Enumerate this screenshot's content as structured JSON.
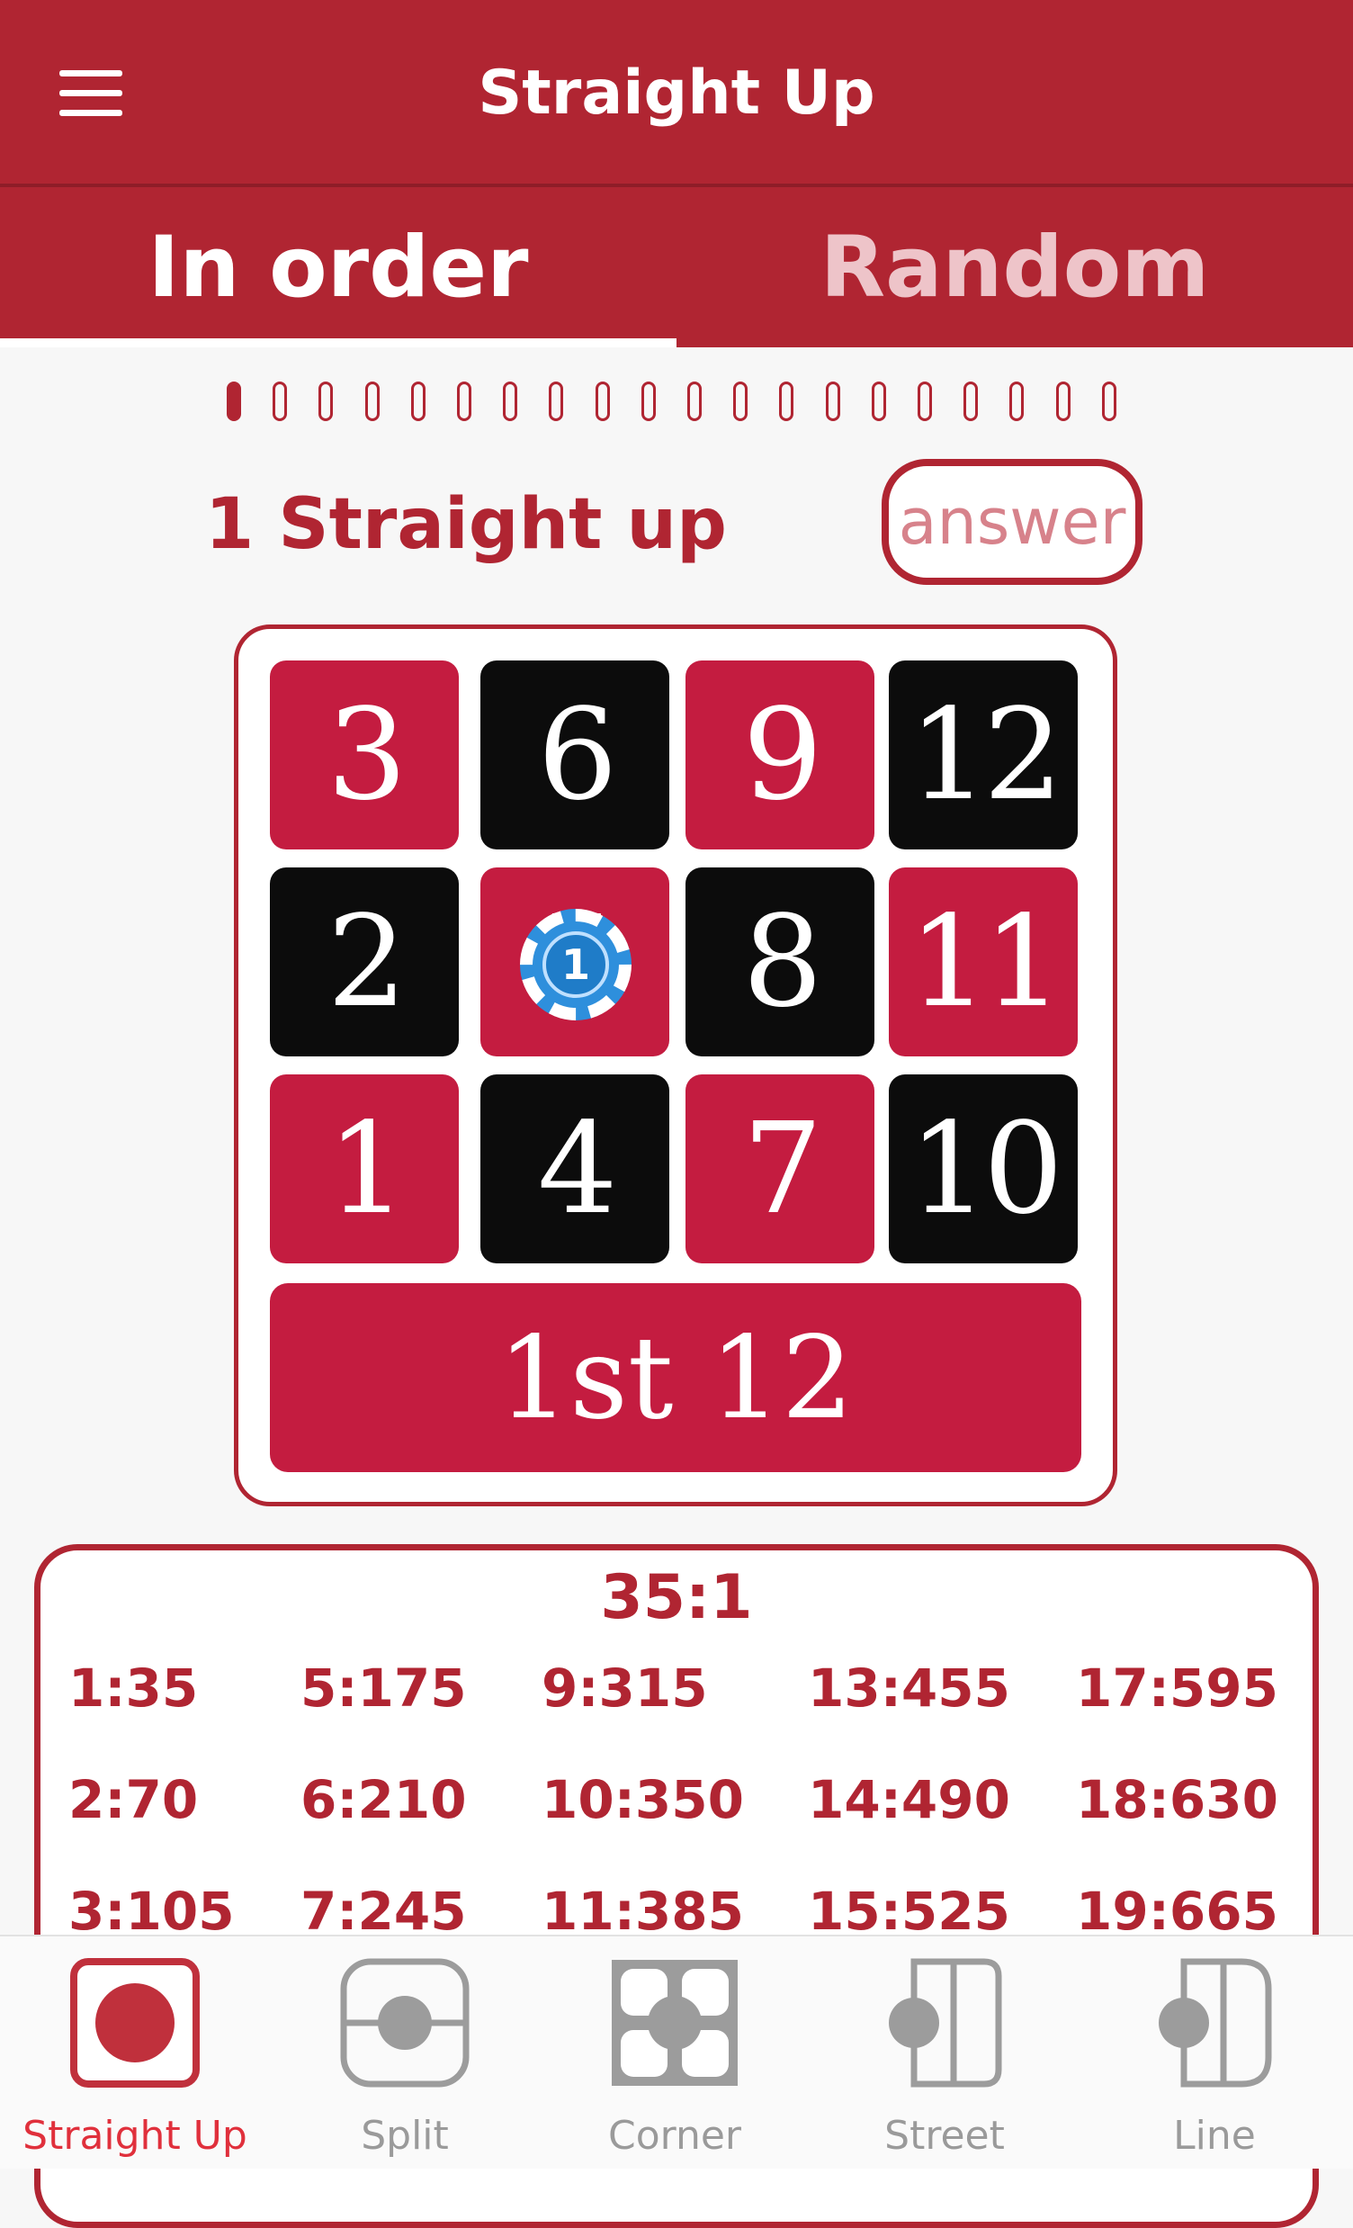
{
  "app": {
    "title": "Straight Up"
  },
  "tabs": [
    {
      "label": "In order",
      "active": true
    },
    {
      "label": "Random",
      "active": false
    }
  ],
  "progress": {
    "total": 20,
    "current": 1
  },
  "question": {
    "title": "1 Straight up",
    "answer_label": "answer"
  },
  "board": {
    "rows": [
      [
        {
          "num": "3",
          "color": "red"
        },
        {
          "num": "6",
          "color": "black"
        },
        {
          "num": "9",
          "color": "red"
        },
        {
          "num": "12",
          "color": "black"
        }
      ],
      [
        {
          "num": "2",
          "color": "black"
        },
        {
          "num": "5",
          "color": "red"
        },
        {
          "num": "8",
          "color": "black"
        },
        {
          "num": "11",
          "color": "red"
        }
      ],
      [
        {
          "num": "1",
          "color": "red"
        },
        {
          "num": "4",
          "color": "black"
        },
        {
          "num": "7",
          "color": "red"
        },
        {
          "num": "10",
          "color": "black"
        }
      ]
    ],
    "dozen": "1st 12",
    "chip": {
      "value": "1",
      "on_number": "5"
    }
  },
  "payout": {
    "ratio": "35:1",
    "columns": [
      [
        "1:35",
        "2:70",
        "3:105"
      ],
      [
        "5:175",
        "6:210",
        "7:245"
      ],
      [
        "9:315",
        "10:350",
        "11:385"
      ],
      [
        "13:455",
        "14:490",
        "15:525"
      ],
      [
        "17:595",
        "18:630",
        "19:665"
      ]
    ]
  },
  "bottom_nav": [
    {
      "label": "Straight Up",
      "icon": "straight-up-icon",
      "active": true
    },
    {
      "label": "Split",
      "icon": "split-icon",
      "active": false
    },
    {
      "label": "Corner",
      "icon": "corner-icon",
      "active": false
    },
    {
      "label": "Street",
      "icon": "street-icon",
      "active": false
    },
    {
      "label": "Line",
      "icon": "line-icon",
      "active": false
    }
  ],
  "colors": {
    "primary": "#b02532",
    "red_cell": "#c41c40",
    "black_cell": "#0c0c0c",
    "chip": "#2e8fdc"
  }
}
